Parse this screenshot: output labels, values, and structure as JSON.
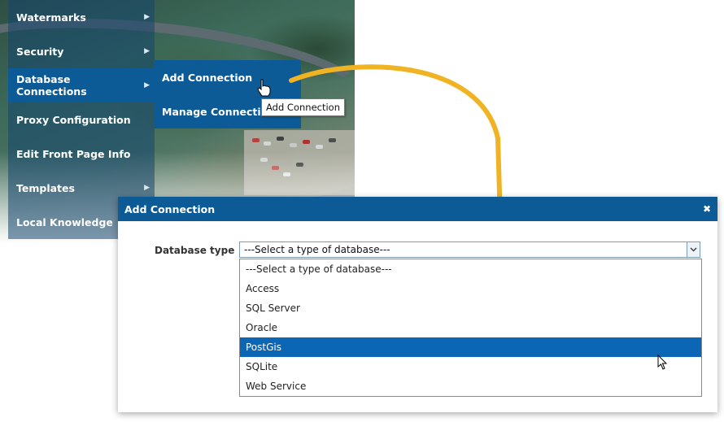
{
  "menu": {
    "items": [
      {
        "label": "Watermarks",
        "has_submenu": true
      },
      {
        "label": "Security",
        "has_submenu": true
      },
      {
        "label": "Database Connections",
        "has_submenu": true,
        "active": true
      },
      {
        "label": "Proxy Configuration",
        "has_submenu": false
      },
      {
        "label": "Edit Front Page Info",
        "has_submenu": false
      },
      {
        "label": "Templates",
        "has_submenu": true
      },
      {
        "label": "Local Knowledge",
        "has_submenu": false
      }
    ],
    "arrow_icon": "chevron-right-icon"
  },
  "submenu": {
    "items": [
      {
        "label": "Add Connection"
      },
      {
        "label": "Manage Connections"
      }
    ]
  },
  "tooltip": {
    "text": "Add Connection"
  },
  "dialog": {
    "title": "Add Connection",
    "close_icon": "close-icon",
    "database_type": {
      "label": "Database type",
      "selected_value": "---Select a type of database---",
      "options": [
        "---Select a type of database---",
        "Access",
        "SQL Server",
        "Oracle",
        "PostGis",
        "SQLite",
        "Web Service"
      ],
      "highlighted": "PostGis"
    }
  },
  "colors": {
    "accent": "#0c5a96",
    "highlight": "#0c66b6",
    "arrow": "#f0b323"
  }
}
